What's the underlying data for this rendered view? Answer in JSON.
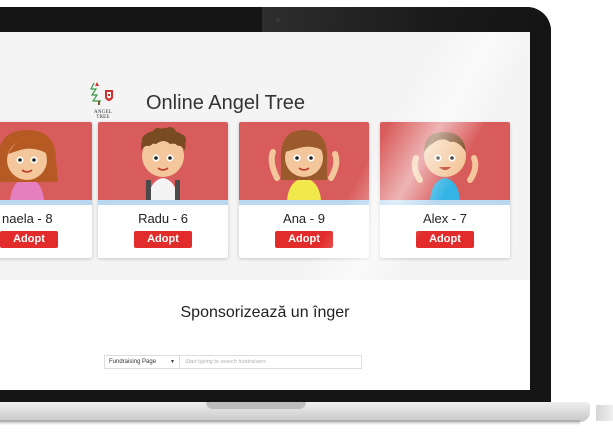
{
  "header": {
    "logo_text": "ANGEL TREE",
    "title": "Online Angel Tree"
  },
  "children": [
    {
      "name": "naela - 8",
      "adopt_label": "Adopt",
      "hair": "#b65a24",
      "shirt": "#e57fbe"
    },
    {
      "name": "Radu - 6",
      "adopt_label": "Adopt",
      "hair": "#7a4a22",
      "shirt": "#f4f4f4"
    },
    {
      "name": "Ana - 9",
      "adopt_label": "Adopt",
      "hair": "#9b5a2b",
      "shirt": "#f1e84c"
    },
    {
      "name": "Alex - 7",
      "adopt_label": "Adopt",
      "hair": "#7a4a22",
      "shirt": "#34b4e4"
    }
  ],
  "sponsor": {
    "heading": "Sponsorizează un înger",
    "select_value": "Fundraising Page",
    "search_placeholder": "Start typing to search fundraisers"
  },
  "colors": {
    "card_bg": "#d95c5c",
    "adopt_button": "#e22b2b",
    "card_stripe": "#b8d7f0"
  }
}
